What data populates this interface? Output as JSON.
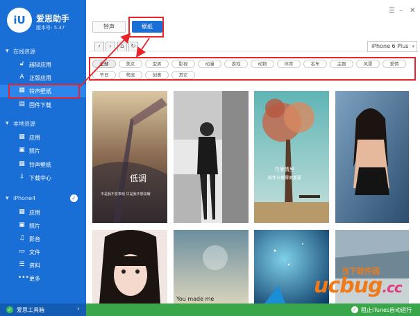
{
  "app": {
    "logo_text": "iU",
    "name": "爱思助手",
    "version": "版本号: 5.37"
  },
  "sidebar": {
    "sections": [
      {
        "label": "在线资源",
        "items": [
          {
            "label": "越狱应用",
            "icon": "unlock-icon"
          },
          {
            "label": "正版应用",
            "icon": "app-store-icon"
          },
          {
            "label": "铃声壁纸",
            "icon": "film-icon"
          },
          {
            "label": "固件下载",
            "icon": "firmware-icon"
          }
        ]
      },
      {
        "label": "本地资源",
        "items": [
          {
            "label": "应用",
            "icon": "apps-grid-icon"
          },
          {
            "label": "照片",
            "icon": "photo-icon"
          },
          {
            "label": "铃声壁纸",
            "icon": "film-icon"
          },
          {
            "label": "下载中心",
            "icon": "download-icon"
          }
        ]
      },
      {
        "label": "iPhone4",
        "items": [
          {
            "label": "应用",
            "icon": "apps-grid-icon"
          },
          {
            "label": "照片",
            "icon": "photo-icon"
          },
          {
            "label": "影音",
            "icon": "music-icon"
          },
          {
            "label": "文件",
            "icon": "folder-icon"
          },
          {
            "label": "资料",
            "icon": "list-icon"
          },
          {
            "label": "更多",
            "icon": "more-icon"
          }
        ]
      }
    ],
    "footer_label": "爱思工具箱"
  },
  "tabs": {
    "ringtone": "铃声",
    "wallpaper": "壁纸"
  },
  "device_select": {
    "value": "iPhone 6 Plus"
  },
  "categories": [
    "全部",
    "美女",
    "型男",
    "影视",
    "动漫",
    "游戏",
    "动物",
    "体育",
    "名车",
    "主题",
    "风景",
    "爱情",
    "节日",
    "萌宠",
    "创意",
    "其它"
  ],
  "active_category": "全部",
  "wallpapers": [
    {
      "caption_main": "低调",
      "caption_sub": "不是我不爱表现 只是我不想炫耀"
    },
    {
      "caption_main": ""
    },
    {
      "caption_main": "在爱情里",
      "caption_sub": "陪伴与懂得更重要"
    },
    {
      "caption_main": ""
    },
    {
      "caption_main": ""
    },
    {
      "caption_main": "You made me"
    },
    {
      "caption_main": ""
    },
    {
      "caption_main": ""
    }
  ],
  "bottom_bar": {
    "label": "阻止iTunes自动运行"
  },
  "watermark": {
    "top": "当下软件园",
    "main": "ucbug",
    "suffix": ".cc"
  }
}
